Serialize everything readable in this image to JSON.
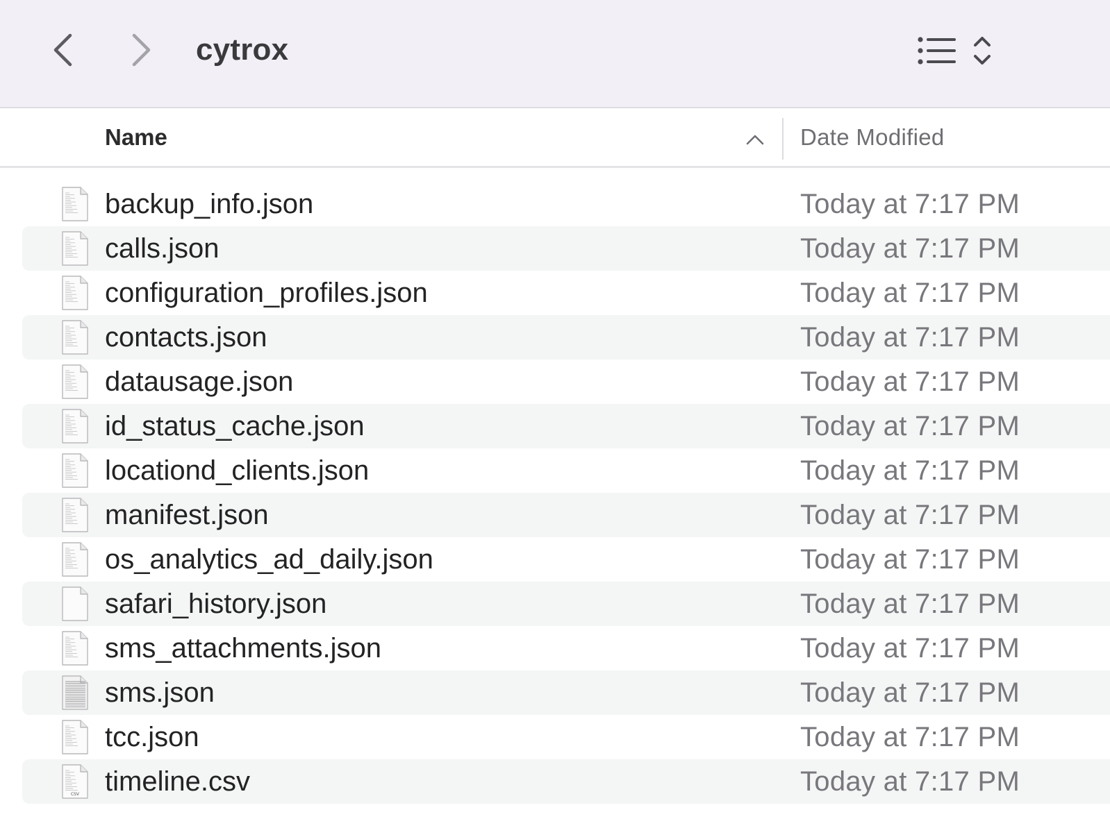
{
  "window": {
    "title": "cytrox"
  },
  "header": {
    "name_label": "Name",
    "date_label": "Date Modified"
  },
  "files": [
    {
      "name": "backup_info.json",
      "date": "Today at 7:17 PM",
      "icon": "json-document-icon"
    },
    {
      "name": "calls.json",
      "date": "Today at 7:17 PM",
      "icon": "json-document-icon"
    },
    {
      "name": "configuration_profiles.json",
      "date": "Today at 7:17 PM",
      "icon": "json-document-icon"
    },
    {
      "name": "contacts.json",
      "date": "Today at 7:17 PM",
      "icon": "json-document-icon"
    },
    {
      "name": "datausage.json",
      "date": "Today at 7:17 PM",
      "icon": "json-document-icon"
    },
    {
      "name": "id_status_cache.json",
      "date": "Today at 7:17 PM",
      "icon": "json-document-icon"
    },
    {
      "name": "locationd_clients.json",
      "date": "Today at 7:17 PM",
      "icon": "json-document-icon"
    },
    {
      "name": "manifest.json",
      "date": "Today at 7:17 PM",
      "icon": "json-document-icon"
    },
    {
      "name": "os_analytics_ad_daily.json",
      "date": "Today at 7:17 PM",
      "icon": "json-document-icon"
    },
    {
      "name": "safari_history.json",
      "date": "Today at 7:17 PM",
      "icon": "blank-document-icon"
    },
    {
      "name": "sms_attachments.json",
      "date": "Today at 7:17 PM",
      "icon": "json-document-icon"
    },
    {
      "name": "sms.json",
      "date": "Today at 7:17 PM",
      "icon": "dense-document-icon"
    },
    {
      "name": "tcc.json",
      "date": "Today at 7:17 PM",
      "icon": "json-document-icon"
    },
    {
      "name": "timeline.csv",
      "date": "Today at 7:17 PM",
      "icon": "csv-document-icon",
      "badge": "CSV"
    }
  ]
}
